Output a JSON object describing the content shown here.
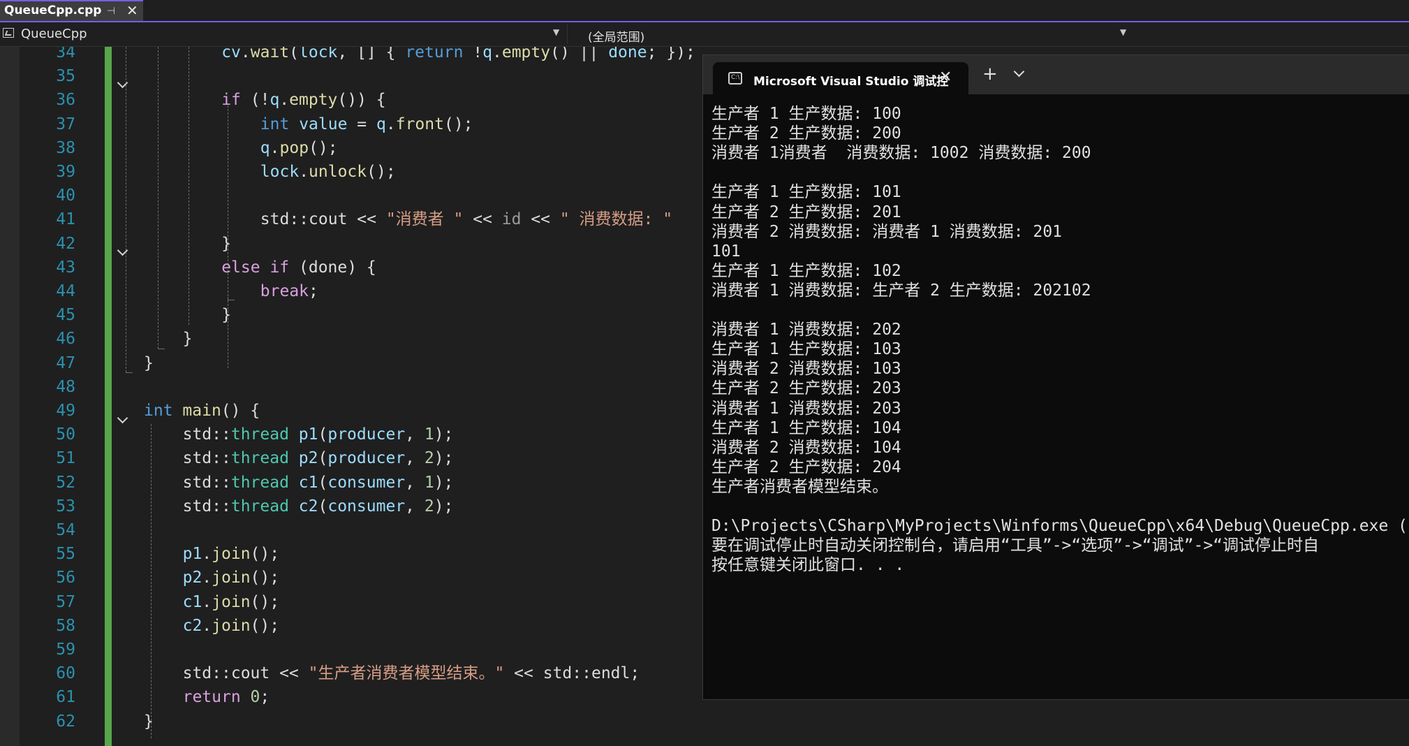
{
  "tab": {
    "title": "QueueCpp.cpp",
    "pin_icon": "⊣",
    "close_icon": "✕"
  },
  "navbar": {
    "project": "QueueCpp",
    "scope": "(全局范围)"
  },
  "editor": {
    "line_numbers": [
      "34",
      "35",
      "36",
      "37",
      "38",
      "39",
      "40",
      "41",
      "42",
      "43",
      "44",
      "45",
      "46",
      "47",
      "48",
      "49",
      "50",
      "51",
      "52",
      "53",
      "54",
      "55",
      "56",
      "57",
      "58",
      "59",
      "60",
      "61",
      "62"
    ]
  },
  "console": {
    "title": "Microsoft Visual Studio 调试控",
    "icon_text": "C:\\",
    "output": [
      "生产者 1 生产数据: 100",
      "生产者 2 生产数据: 200",
      "消费者 1消费者  消费数据: 1002 消费数据: 200",
      "",
      "生产者 1 生产数据: 101",
      "生产者 2 生产数据: 201",
      "消费者 2 消费数据: 消费者 1 消费数据: 201",
      "101",
      "生产者 1 生产数据: 102",
      "消费者 1 消费数据: 生产者 2 生产数据: 202102",
      "",
      "消费者 1 消费数据: 202",
      "生产者 1 生产数据: 103",
      "消费者 2 消费数据: 103",
      "生产者 2 生产数据: 203",
      "消费者 1 消费数据: 203",
      "生产者 1 生产数据: 104",
      "消费者 2 消费数据: 104",
      "生产者 2 生产数据: 204",
      "生产者消费者模型结束。",
      "",
      "D:\\Projects\\CSharp\\MyProjects\\Winforms\\QueueCpp\\x64\\Debug\\QueueCpp.exe (",
      "要在调试停止时自动关闭控制台，请启用“工具”->“选项”->“调试”->“调试停止时自",
      "按任意键关闭此窗口. . ."
    ]
  },
  "code": {
    "l34": [
      "cv",
      ".",
      "wait",
      "(",
      "lock",
      ", [] { ",
      "return",
      " !",
      "q",
      ".",
      "empty",
      "() || ",
      "done",
      "; });"
    ],
    "l36": [
      "if",
      " (!",
      "q",
      ".",
      "empty",
      "()) {"
    ],
    "l37": [
      "int",
      " ",
      "value",
      " = ",
      "q",
      ".",
      "front",
      "();"
    ],
    "l38": [
      "q",
      ".",
      "pop",
      "();"
    ],
    "l39": [
      "lock",
      ".",
      "unlock",
      "();"
    ],
    "l41": [
      "std",
      "::",
      "cout",
      " << ",
      "\"消费者 \"",
      " << ",
      "id",
      " << ",
      "\" 消费数据: \""
    ],
    "l42": [
      "}"
    ],
    "l43": [
      "else",
      " ",
      "if",
      " (",
      "done",
      ") {"
    ],
    "l44": [
      "break",
      ";"
    ],
    "l45": [
      "}"
    ],
    "l46": [
      "}"
    ],
    "l47": [
      "}"
    ],
    "l49": [
      "int",
      " ",
      "main",
      "() {"
    ],
    "l50": [
      "std",
      "::",
      "thread",
      " ",
      "p1",
      "(",
      "producer",
      ", ",
      "1",
      ");"
    ],
    "l51": [
      "std",
      "::",
      "thread",
      " ",
      "p2",
      "(",
      "producer",
      ", ",
      "2",
      ");"
    ],
    "l52": [
      "std",
      "::",
      "thread",
      " ",
      "c1",
      "(",
      "consumer",
      ", ",
      "1",
      ");"
    ],
    "l53": [
      "std",
      "::",
      "thread",
      " ",
      "c2",
      "(",
      "consumer",
      ", ",
      "2",
      ");"
    ],
    "l55": [
      "p1",
      ".",
      "join",
      "();"
    ],
    "l56": [
      "p2",
      ".",
      "join",
      "();"
    ],
    "l57": [
      "c1",
      ".",
      "join",
      "();"
    ],
    "l58": [
      "c2",
      ".",
      "join",
      "();"
    ],
    "l60": [
      "std",
      "::",
      "cout",
      " << ",
      "\"生产者消费者模型结束。\"",
      " << ",
      "std",
      "::",
      "endl",
      ";"
    ],
    "l61": [
      "return",
      " ",
      "0",
      ";"
    ],
    "l62": [
      "}"
    ]
  },
  "colors": {
    "accent": "#7160e8",
    "change_bar": "#57a64a",
    "keyword": "#569cd6",
    "control_keyword": "#d8a0df",
    "function": "#dcdcaa",
    "variable": "#9cdcfe",
    "type": "#4ec9b0",
    "string": "#d69d85",
    "number": "#b5cea8",
    "line_number": "#2b91af"
  }
}
